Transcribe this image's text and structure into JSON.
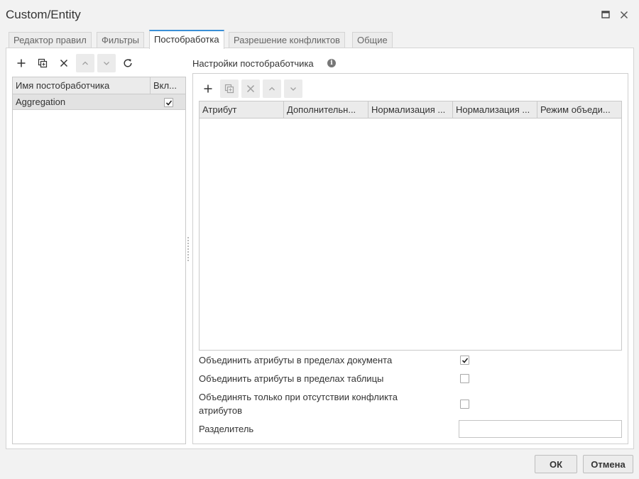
{
  "window": {
    "title": "Custom/Entity"
  },
  "tabs": [
    {
      "label": "Редактор правил"
    },
    {
      "label": "Фильтры"
    },
    {
      "label": "Постобработка"
    },
    {
      "label": "Разрешение конфликтов"
    },
    {
      "label": "Общие"
    }
  ],
  "left_grid": {
    "columns": [
      "Имя постобработчика",
      "Вкл..."
    ],
    "rows": [
      {
        "name": "Aggregation",
        "enabled": true
      }
    ]
  },
  "settings": {
    "title": "Настройки постобработчика",
    "columns": [
      "Атрибут",
      "Дополнительн...",
      "Нормализация ...",
      "Нормализация ...",
      "Режим объеди..."
    ],
    "options": [
      {
        "label": "Объединить атрибуты в пределах документа",
        "checked": true
      },
      {
        "label": "Объединить атрибуты в пределах таблицы",
        "checked": false
      },
      {
        "label": "Объединять только при отсутствии конфликта атрибутов",
        "checked": false
      }
    ],
    "separator_label": "Разделитель",
    "separator_value": ""
  },
  "footer": {
    "ok_label": "ОК",
    "cancel_label": "Отмена"
  }
}
